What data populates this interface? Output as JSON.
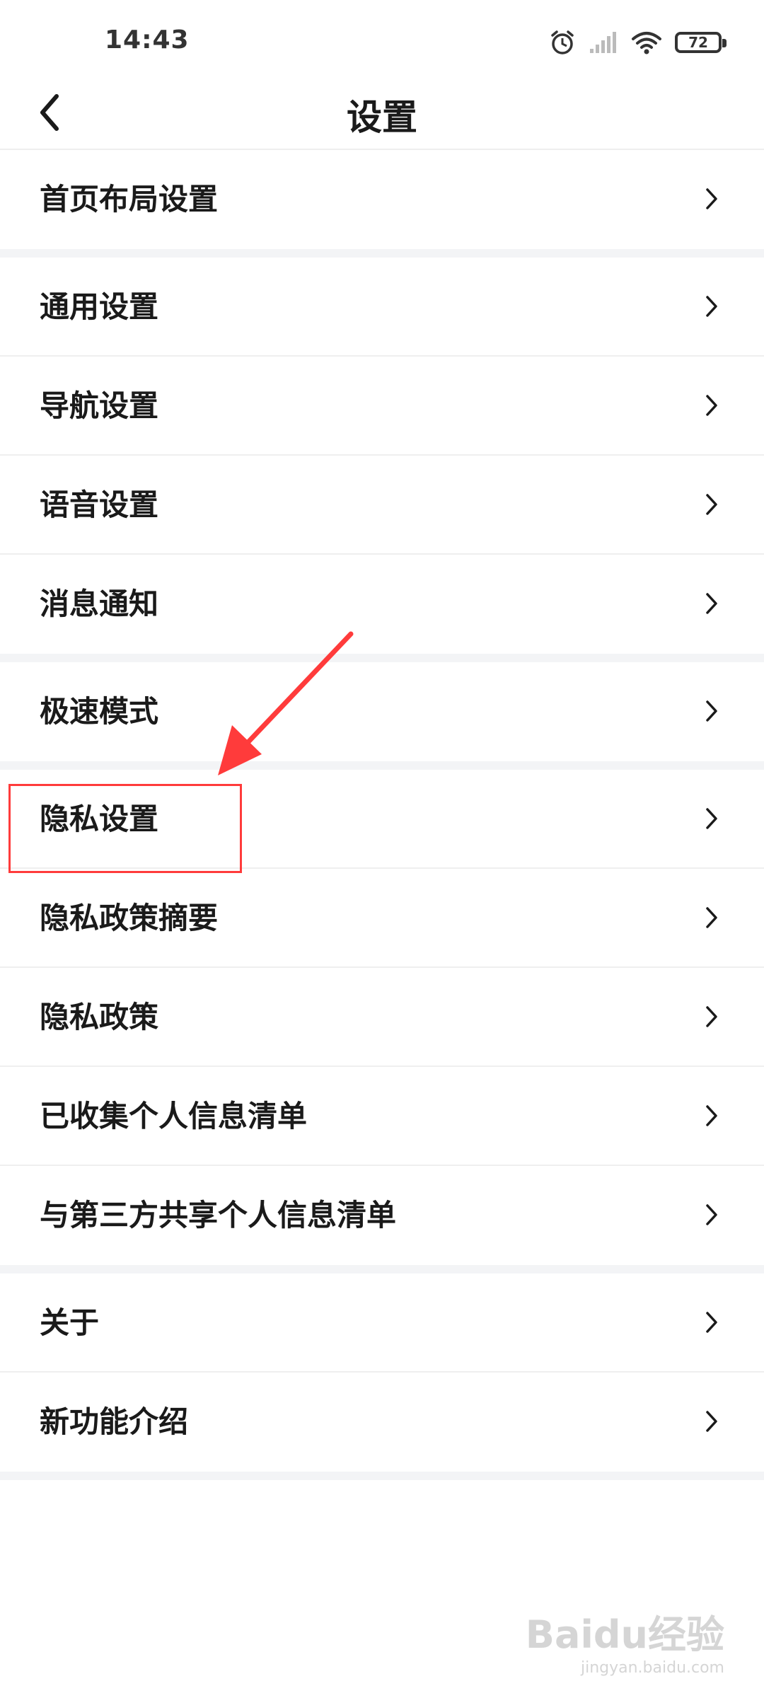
{
  "status_bar": {
    "time": "14:43",
    "battery": "72",
    "icons": [
      "alarm-icon",
      "signal-icon",
      "wifi-icon",
      "battery-icon"
    ]
  },
  "header": {
    "title": "设置",
    "back_icon": "chevron-left-icon"
  },
  "groups": [
    {
      "items": [
        {
          "label": "首页布局设置"
        }
      ]
    },
    {
      "items": [
        {
          "label": "通用设置"
        },
        {
          "label": "导航设置"
        },
        {
          "label": "语音设置"
        },
        {
          "label": "消息通知"
        }
      ]
    },
    {
      "items": [
        {
          "label": "极速模式"
        }
      ]
    },
    {
      "items": [
        {
          "label": "隐私设置"
        },
        {
          "label": "隐私政策摘要"
        },
        {
          "label": "隐私政策"
        },
        {
          "label": "已收集个人信息清单"
        },
        {
          "label": "与第三方共享个人信息清单"
        }
      ]
    },
    {
      "items": [
        {
          "label": "关于"
        },
        {
          "label": "新功能介绍"
        }
      ]
    }
  ],
  "annotation": {
    "highlight_color": "#ff3b3b"
  },
  "watermark": {
    "logo": "Baidu经验",
    "sub": "jingyan.baidu.com"
  }
}
